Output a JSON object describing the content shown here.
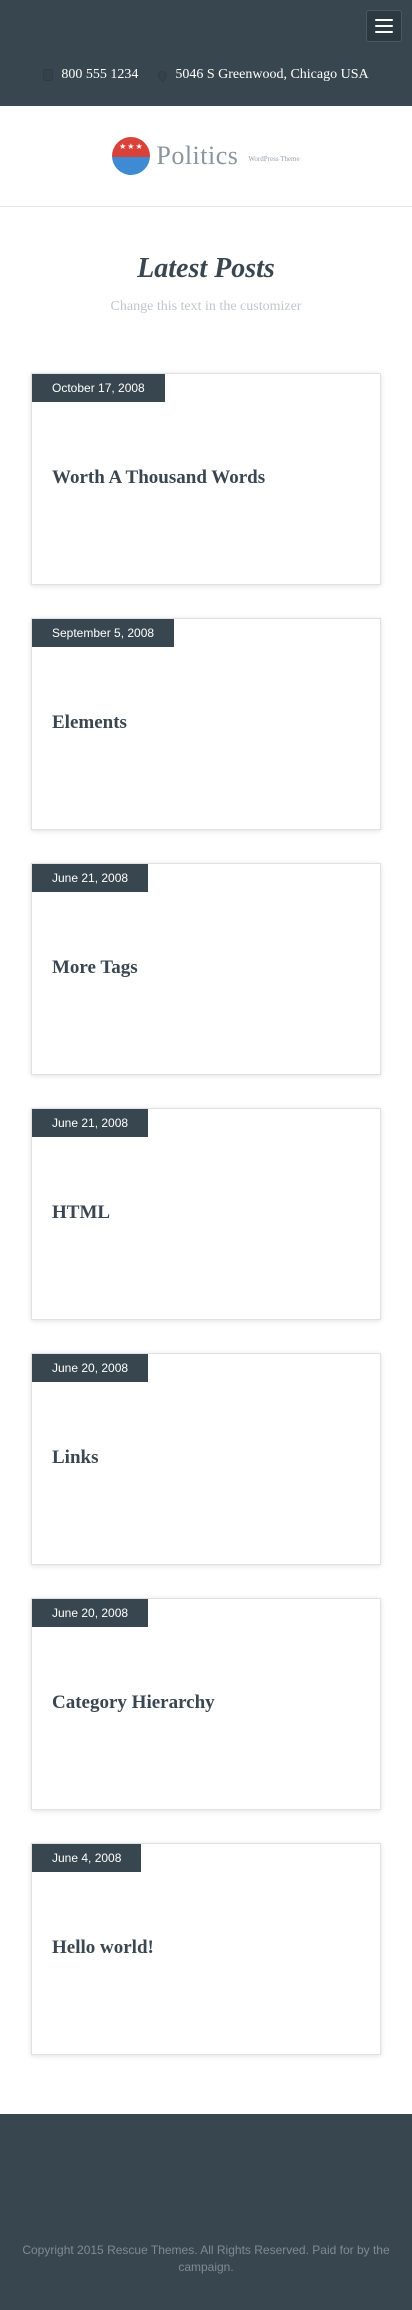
{
  "topbar": {
    "phone": "800 555 1234",
    "address": "5046 S Greenwood, Chicago USA"
  },
  "logo": {
    "name": "Politics",
    "tagline": "WordPress Theme"
  },
  "section": {
    "title": "Latest Posts",
    "subtitle": "Change this text in the customizer"
  },
  "posts": [
    {
      "date": "October 17, 2008",
      "title": "Worth A Thousand Words"
    },
    {
      "date": "September 5, 2008",
      "title": "Elements"
    },
    {
      "date": "June 21, 2008",
      "title": "More Tags"
    },
    {
      "date": "June 21, 2008",
      "title": "HTML"
    },
    {
      "date": "June 20, 2008",
      "title": "Links"
    },
    {
      "date": "June 20, 2008",
      "title": "Category Hierarchy"
    },
    {
      "date": "June 4, 2008",
      "title": "Hello world!"
    }
  ],
  "footer": {
    "copyright": "Copyright 2015 Rescue Themes. All Rights Reserved. Paid for by the campaign."
  },
  "colors": {
    "dark": "#37464f",
    "badge_red": "#d9423b",
    "badge_blue": "#3f8bd3"
  }
}
